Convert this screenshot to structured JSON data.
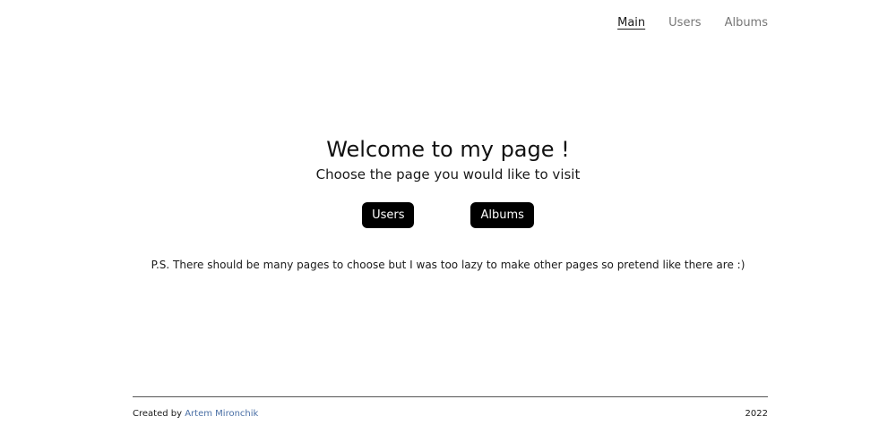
{
  "nav": {
    "items": [
      {
        "label": "Main",
        "active": true
      },
      {
        "label": "Users",
        "active": false
      },
      {
        "label": "Albums",
        "active": false
      }
    ]
  },
  "hero": {
    "title": "Welcome to my page !",
    "subtitle": "Choose the page you would like to visit"
  },
  "buttons": {
    "users_label": "Users",
    "albums_label": "Albums"
  },
  "note": "P.S. There should be many pages to choose but I was too lazy to make other pages so pretend like there are :)",
  "footer": {
    "created_by_prefix": "Created by",
    "author": "Artem Mironchik",
    "year": "2022"
  },
  "colors": {
    "button_bg": "#000000",
    "button_text": "#ffffff",
    "link_author": "#4a6fa5",
    "nav_inactive": "#777777"
  }
}
